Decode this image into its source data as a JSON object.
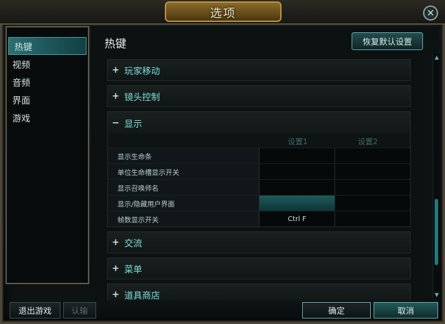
{
  "window": {
    "title": "选项",
    "close_icon": "×"
  },
  "sidebar": {
    "items": [
      {
        "label": "热键",
        "active": true
      },
      {
        "label": "视频"
      },
      {
        "label": "音频"
      },
      {
        "label": "界面"
      },
      {
        "label": "游戏"
      }
    ]
  },
  "header": {
    "title": "热键",
    "restore_label": "恢复默认设置"
  },
  "categories": {
    "player_move": {
      "sign": "+",
      "label": "玩家移动"
    },
    "camera": {
      "sign": "+",
      "label": "镜头控制"
    },
    "display": {
      "sign": "−",
      "label": "显示"
    },
    "chat": {
      "sign": "+",
      "label": "交流"
    },
    "menu": {
      "sign": "+",
      "label": "菜单"
    },
    "shop": {
      "sign": "+",
      "label": "道具商店"
    }
  },
  "display_table": {
    "col1": "设置1",
    "col2": "设置2",
    "rows": [
      {
        "name": "显示生命条",
        "slot1": "",
        "slot2": ""
      },
      {
        "name": "单位生命槽显示开关",
        "slot1": "",
        "slot2": ""
      },
      {
        "name": "显示召唤师名",
        "slot1": "",
        "slot2": ""
      },
      {
        "name": "显示/隐藏用户界面",
        "slot1": "",
        "slot2": ""
      },
      {
        "name": "帧数显示开关",
        "slot1": "Ctrl  F",
        "slot2": ""
      }
    ]
  },
  "footer": {
    "quit_label": "退出游戏",
    "surrender_label": "认输",
    "ok_label": "确定",
    "cancel_label": "取消"
  },
  "scroll": {
    "up_icon": "▲",
    "down_icon": "▼"
  },
  "colors": {
    "accent": "#2b6f73",
    "category_text": "#7ee0dc",
    "frame_gold": "#b8943f"
  }
}
